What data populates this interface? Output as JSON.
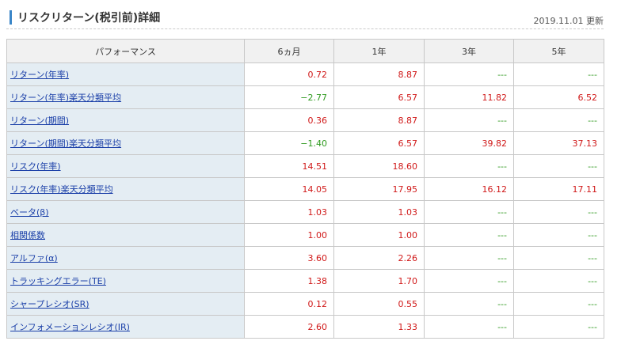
{
  "header": {
    "title": "リスクリターン(税引前)詳細",
    "updated": "2019.11.01 更新"
  },
  "table": {
    "columns": [
      "パフォーマンス",
      "6ヵ月",
      "1年",
      "3年",
      "5年"
    ],
    "rows": [
      {
        "label": "リターン(年率)",
        "values": [
          "0.72",
          "8.87",
          "---",
          "---"
        ]
      },
      {
        "label": "リターン(年率)楽天分類平均",
        "values": [
          "−2.77",
          "6.57",
          "11.82",
          "6.52"
        ]
      },
      {
        "label": "リターン(期間)",
        "values": [
          "0.36",
          "8.87",
          "---",
          "---"
        ]
      },
      {
        "label": "リターン(期間)楽天分類平均",
        "values": [
          "−1.40",
          "6.57",
          "39.82",
          "37.13"
        ]
      },
      {
        "label": "リスク(年率)",
        "values": [
          "14.51",
          "18.60",
          "---",
          "---"
        ]
      },
      {
        "label": "リスク(年率)楽天分類平均",
        "values": [
          "14.05",
          "17.95",
          "16.12",
          "17.11"
        ]
      },
      {
        "label": "ベータ(β)",
        "values": [
          "1.03",
          "1.03",
          "---",
          "---"
        ]
      },
      {
        "label": "相関係数",
        "values": [
          "1.00",
          "1.00",
          "---",
          "---"
        ]
      },
      {
        "label": "アルファ(α)",
        "values": [
          "3.60",
          "2.26",
          "---",
          "---"
        ]
      },
      {
        "label": "トラッキングエラー(TE)",
        "values": [
          "1.38",
          "1.70",
          "---",
          "---"
        ]
      },
      {
        "label": "シャープレシオ(SR)",
        "values": [
          "0.12",
          "0.55",
          "---",
          "---"
        ]
      },
      {
        "label": "インフォメーションレシオ(IR)",
        "values": [
          "2.60",
          "1.33",
          "---",
          "---"
        ]
      }
    ]
  },
  "colors": {
    "positive": "#d01818",
    "negative": "#2e9a1e",
    "link": "#1a3fa8",
    "accent": "#3a86c8"
  }
}
